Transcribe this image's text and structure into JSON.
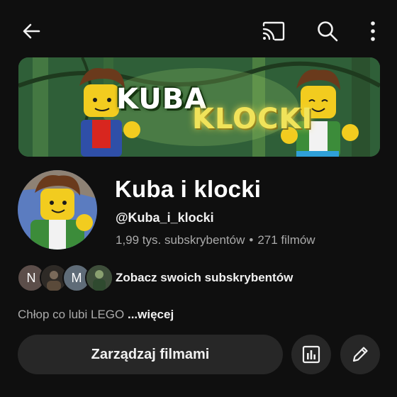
{
  "icons": {
    "back": "arrow-back-icon",
    "cast": "cast-icon",
    "search": "search-icon",
    "more": "more-vertical-icon",
    "analytics": "analytics-icon",
    "edit": "pencil-icon"
  },
  "banner": {
    "title_line1": "KUBA",
    "title_line2": "KLOCKI"
  },
  "channel": {
    "name": "Kuba i klocki",
    "handle": "@Kuba_i_klocki",
    "subscribers": "1,99 tys. subskrybentów",
    "separator": "•",
    "videos": "271 filmów"
  },
  "subscribers_preview": {
    "avatars": [
      {
        "initial": "N",
        "color": "#5c4e4a"
      },
      {
        "initial": "",
        "color": "#3a3a3a"
      },
      {
        "initial": "M",
        "color": "#5f6c78"
      },
      {
        "initial": "",
        "color": "#4a5a4a"
      }
    ],
    "label": "Zobacz swoich subskrybentów"
  },
  "description": {
    "text": "Chłop co lubi LEGO",
    "more_label": "...więcej"
  },
  "actions": {
    "manage_videos_label": "Zarządzaj filmami"
  },
  "colors": {
    "background": "#0f0f0f",
    "button_bg": "#272727",
    "secondary_text": "#aaaaaa",
    "primary_text": "#f1f1f1"
  }
}
